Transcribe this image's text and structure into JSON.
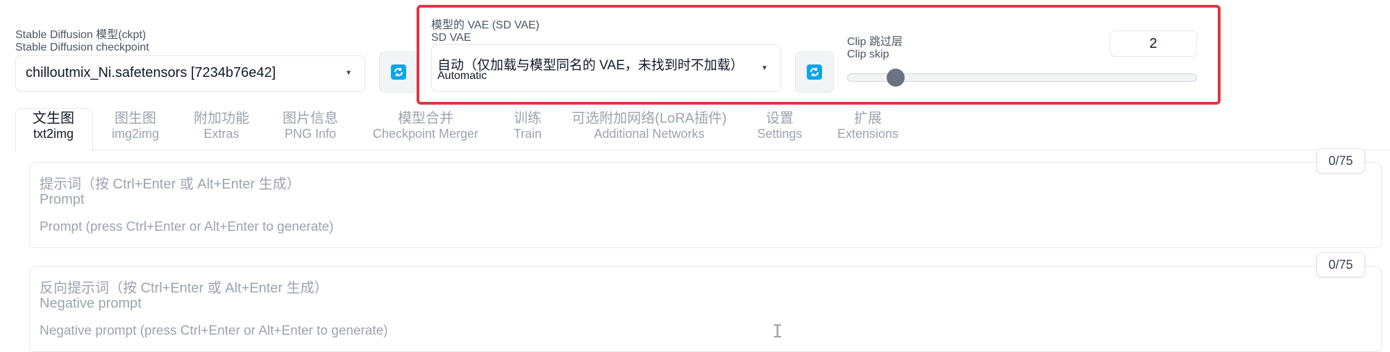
{
  "checkpoint": {
    "label_cn": "Stable Diffusion 模型(ckpt)",
    "label_en": "Stable Diffusion checkpoint",
    "value": "chilloutmix_Ni.safetensors [7234b76e42]",
    "chevron_icon": "chevron-down-icon",
    "refresh_icon": "refresh-icon"
  },
  "vae": {
    "label_cn": "模型的 VAE (SD VAE)",
    "label_en": "SD VAE",
    "value_cn": "自动（仅加载与模型同名的 VAE，未找到时不加载）",
    "value_en": "Automatic",
    "chevron_icon": "chevron-down-icon",
    "refresh_icon": "refresh-icon"
  },
  "clip_skip": {
    "label_cn": "Clip 跳过层",
    "label_en": "Clip skip",
    "value": "2",
    "min": 1,
    "max": 12,
    "slider_value": 2
  },
  "tabs": [
    {
      "cn": "文生图",
      "en": "txt2img",
      "active": true
    },
    {
      "cn": "图生图",
      "en": "img2img",
      "active": false
    },
    {
      "cn": "附加功能",
      "en": "Extras",
      "active": false
    },
    {
      "cn": "图片信息",
      "en": "PNG Info",
      "active": false
    },
    {
      "cn": "模型合并",
      "en": "Checkpoint Merger",
      "active": false
    },
    {
      "cn": "训练",
      "en": "Train",
      "active": false
    },
    {
      "cn": "可选附加网络(LoRA插件)",
      "en": "Additional Networks",
      "active": false
    },
    {
      "cn": "设置",
      "en": "Settings",
      "active": false
    },
    {
      "cn": "扩展",
      "en": "Extensions",
      "active": false
    }
  ],
  "prompt": {
    "label_cn": "提示词（按 Ctrl+Enter 或 Alt+Enter 生成）",
    "label_en": "Prompt",
    "placeholder": "Prompt (press Ctrl+Enter or Alt+Enter to generate)",
    "token_count": "0/75"
  },
  "negative_prompt": {
    "label_cn": "反向提示词（按 Ctrl+Enter 或 Alt+Enter 生成）",
    "label_en": "Negative prompt",
    "placeholder": "Negative prompt (press Ctrl+Enter or Alt+Enter to generate)",
    "token_count": "0/75"
  },
  "colors": {
    "accent": "#0ea5e9",
    "highlight": "#dc3545",
    "slider_thumb": "#6b7280"
  }
}
